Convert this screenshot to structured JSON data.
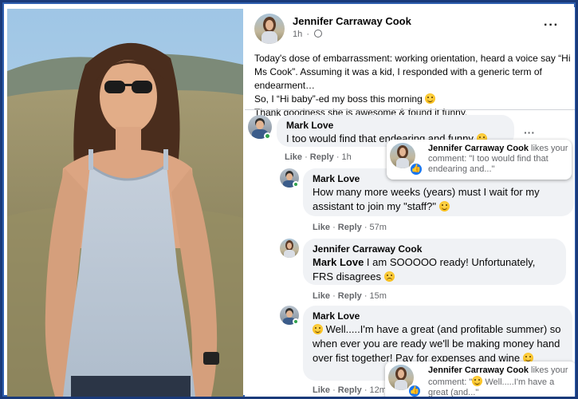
{
  "post": {
    "author": "Jennifer Carraway Cook",
    "time": "1h",
    "more": "···",
    "body": [
      "Today's dose of embarrassment: working orientation, heard a voice say “Hi Ms Cook”. Assuming it was a kid, I responded with a generic term of endearment…",
      "So, I “Hi baby”-ed my boss this morning",
      "Thank goodness she is awesome & found it funny."
    ]
  },
  "comments": [
    {
      "author": "Mark Love",
      "text": "I too would find that endearing and funny",
      "like": "Like",
      "reply": "Reply",
      "time": "1h",
      "more": "···"
    },
    {
      "author": "Mark Love",
      "text": "How many more weeks (years) must I wait for my assistant to join my \"staff?\"",
      "like": "Like",
      "reply": "Reply",
      "time": "57m"
    },
    {
      "author": "Jennifer Carraway Cook",
      "mention": "Mark Love",
      "text": " I am SOOOOO ready! Unfortunately, FRS disagrees",
      "like": "Like",
      "reply": "Reply",
      "time": "15m"
    },
    {
      "author": "Mark Love",
      "text": "Well.....I'm have a great (and profitable summer) so when ever you are ready we'll be making money hand over fist together! Pay for expenses and wine",
      "like": "Like",
      "reply": "Reply",
      "time": "12m"
    }
  ],
  "notifications": [
    {
      "name": "Jennifer Carraway Cook",
      "action": " likes your comment: \"I too would find that endearing and...\""
    },
    {
      "name": "Jennifer Carraway Cook",
      "action": " likes your comment: \"",
      "quote": " Well.....I'm have a great (and...\""
    }
  ],
  "colors": {
    "frame": "#1a3a7a",
    "bubble": "#f0f2f5",
    "like_blue": "#1877f2",
    "online": "#31a24c",
    "meta_text": "#65676b"
  },
  "icons": [
    "globe-icon",
    "more-options-icon",
    "smile-emoji-icon",
    "sad-emoji-icon",
    "like-thumb-icon"
  ]
}
